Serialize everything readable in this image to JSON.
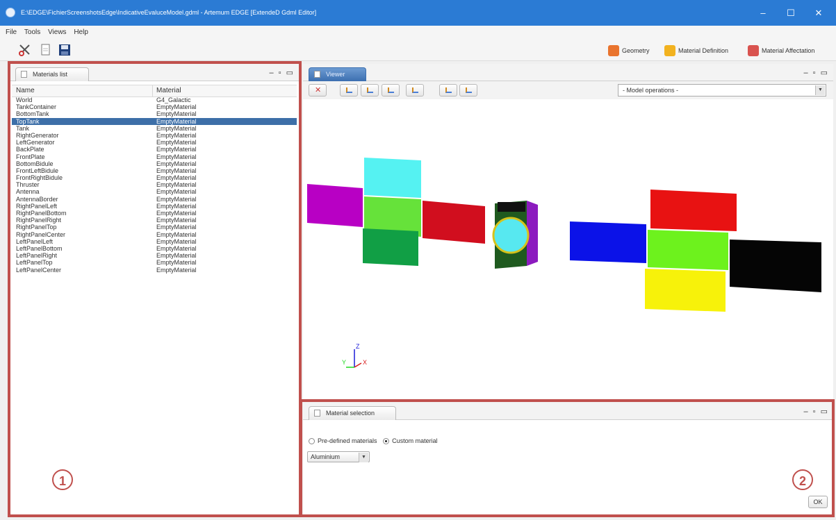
{
  "window": {
    "title": "E:\\EDGE\\FichierScreenshotsEdge\\IndicativeEvaluceModel.gdml - Artemum EDGE [ExtendeD Gdml Editor]",
    "controls": {
      "minimize": "–",
      "maximize": "☐",
      "close": "✕"
    }
  },
  "menu": [
    "File",
    "Tools",
    "Views",
    "Help"
  ],
  "toolbar": {
    "icons": [
      "scissors-icon",
      "document-icon",
      "save-icon"
    ],
    "modes": [
      {
        "label": "Geometry",
        "icon": "geometry-icon",
        "color": "#e9742e"
      },
      {
        "label": "Material Definition",
        "icon": "material-definition-icon",
        "color": "#f2b21f"
      },
      {
        "label": "Material Affectation",
        "icon": "material-affectation-icon",
        "color": "#d9534f"
      }
    ]
  },
  "materials_panel": {
    "tab": "Materials list",
    "controls": "– ▫ ▭",
    "columns": [
      "Name",
      "Material"
    ],
    "rows": [
      {
        "name": "World",
        "material": "G4_Galactic"
      },
      {
        "name": "TankContainer",
        "material": "EmptyMaterial"
      },
      {
        "name": "BottomTank",
        "material": "EmptyMaterial"
      },
      {
        "name": "TopTank",
        "material": "EmptyMaterial",
        "selected": true
      },
      {
        "name": "Tank",
        "material": "EmptyMaterial"
      },
      {
        "name": "RightGenerator",
        "material": "EmptyMaterial"
      },
      {
        "name": "LeftGenerator",
        "material": "EmptyMaterial"
      },
      {
        "name": "BackPlate",
        "material": "EmptyMaterial"
      },
      {
        "name": "FrontPlate",
        "material": "EmptyMaterial"
      },
      {
        "name": "BottomBidule",
        "material": "EmptyMaterial"
      },
      {
        "name": "FrontLeftBidule",
        "material": "EmptyMaterial"
      },
      {
        "name": "FrontRightBidule",
        "material": "EmptyMaterial"
      },
      {
        "name": "Thruster",
        "material": "EmptyMaterial"
      },
      {
        "name": "Antenna",
        "material": "EmptyMaterial"
      },
      {
        "name": "AntennaBorder",
        "material": "EmptyMaterial"
      },
      {
        "name": "RightPanelLeft",
        "material": "EmptyMaterial"
      },
      {
        "name": "RightPanelBottom",
        "material": "EmptyMaterial"
      },
      {
        "name": "RightPanelRight",
        "material": "EmptyMaterial"
      },
      {
        "name": "RightPanelTop",
        "material": "EmptyMaterial"
      },
      {
        "name": "RightPanelCenter",
        "material": "EmptyMaterial"
      },
      {
        "name": "LeftPanelLeft",
        "material": "EmptyMaterial"
      },
      {
        "name": "LeftPanelBottom",
        "material": "EmptyMaterial"
      },
      {
        "name": "LeftPanelRight",
        "material": "EmptyMaterial"
      },
      {
        "name": "LeftPanelTop",
        "material": "EmptyMaterial"
      },
      {
        "name": "LeftPanelCenter",
        "material": "EmptyMaterial"
      }
    ]
  },
  "viewer": {
    "tab": "Viewer",
    "controls": "– ▫ ▭",
    "view_buttons": [
      "reset-view-icon",
      "view-front-icon",
      "view-back-icon",
      "view-top-icon",
      "view-bottom-icon",
      "view-left-icon",
      "view-right-icon"
    ],
    "model_operations": "- Model operations -",
    "axes": {
      "x": "X",
      "y": "Y",
      "z": "Z"
    }
  },
  "material_selection": {
    "tab": "Material selection",
    "controls": "– ▫ ▭",
    "option_predefined": "Pre-defined materials",
    "option_custom": "Custom material",
    "selected_option": "custom",
    "material_value": "Aluminium",
    "ok_label": "OK"
  },
  "callouts": [
    "1",
    "2"
  ],
  "colors": {
    "titlebar": "#2b7bd4",
    "selection": "#3d6fa8",
    "callout": "#c0504d"
  }
}
